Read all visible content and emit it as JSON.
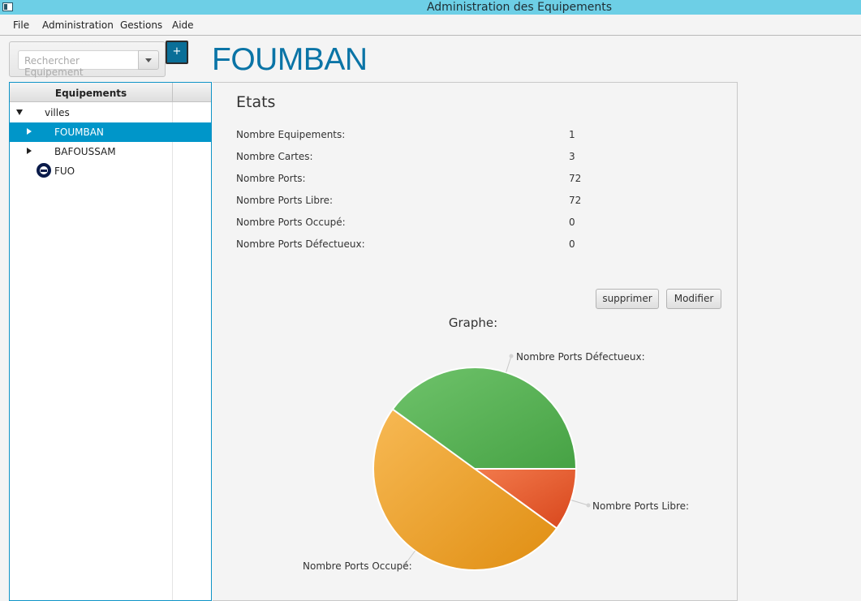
{
  "window": {
    "title": "Administration des Equipements"
  },
  "menu": {
    "items": [
      "File",
      "Administration",
      "Gestions",
      "Aide"
    ]
  },
  "search": {
    "placeholder": "Rechercher Equipement",
    "add_label": "+"
  },
  "header": {
    "city": "FOUMBAN"
  },
  "tree": {
    "header": "Equipements",
    "root": "villes",
    "items": [
      {
        "label": "FOUMBAN",
        "selected": true
      },
      {
        "label": "BAFOUSSAM",
        "selected": false
      }
    ],
    "leaf": "FUO"
  },
  "etats": {
    "title": "Etats",
    "stats": [
      {
        "label": "Nombre Equipements:",
        "value": "1"
      },
      {
        "label": "Nombre Cartes:",
        "value": "3"
      },
      {
        "label": "Nombre Ports:",
        "value": "72"
      },
      {
        "label": "Nombre Ports Libre:",
        "value": "72"
      },
      {
        "label": "Nombre Ports Occupé:",
        "value": "0"
      },
      {
        "label": "Nombre Ports Défectueux:",
        "value": "0"
      }
    ]
  },
  "actions": {
    "delete_label": "supprimer",
    "modify_label": "Modifier"
  },
  "chart_data": {
    "type": "pie",
    "title": "Graphe:",
    "slices": [
      {
        "label": "Nombre Ports Libre:",
        "value": 10,
        "color": "#e0582a"
      },
      {
        "label": "Nombre Ports Occupé:",
        "value": 50,
        "color": "#eb9c1f"
      },
      {
        "label": "Nombre Ports Défectueux:",
        "value": 40,
        "color": "#58ad54"
      }
    ]
  },
  "colors": {
    "accent": "#0096c9",
    "title_blue": "#0a74a6",
    "titlebar": "#6dcfe6"
  }
}
